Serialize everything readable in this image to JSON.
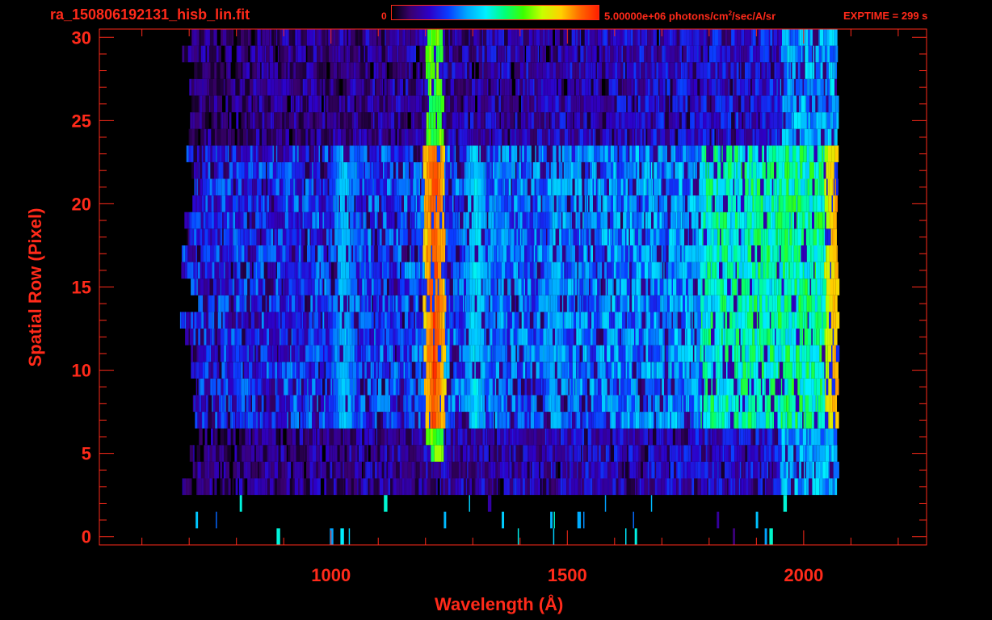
{
  "header": {
    "filename": "ra_150806192131_hisb_lin.fit",
    "colorbar_min_label": "0",
    "colorbar_max_label_pre": "5.00000e+06 photons/cm",
    "colorbar_max_label_sup": "2",
    "colorbar_max_label_post": "/sec/A/sr",
    "exptime_label": "EXPTIME = 299 s"
  },
  "colors": {
    "axis": "#ff2a1a",
    "background": "#000000",
    "colormap": [
      "#000000",
      "#3a0070",
      "#2d00c8",
      "#0a3cff",
      "#00a8ff",
      "#00f0ff",
      "#00ff7a",
      "#3cff00",
      "#c8ff00",
      "#ffd000",
      "#ff6a00",
      "#ff2000"
    ]
  },
  "chart_data": {
    "type": "heatmap",
    "title": "ra_150806192131_hisb_lin.fit",
    "xlabel": "Wavelength (Å)",
    "ylabel": "Spatial Row (Pixel)",
    "xlim": [
      510,
      2260
    ],
    "ylim": [
      -0.5,
      30.5
    ],
    "x_ticks": [
      1000,
      1500,
      2000
    ],
    "y_ticks": [
      0,
      5,
      10,
      15,
      20,
      25,
      30
    ],
    "colorbar": {
      "min": 0,
      "max": 5000000,
      "unit": "photons/cm^2/sec/A/sr"
    },
    "grid": false,
    "data_x_range": [
      690,
      2070
    ],
    "slit_rows": [
      7,
      23
    ],
    "emission_features": [
      {
        "wavelength": 1025,
        "relative_intensity": 0.42
      },
      {
        "wavelength": 1216,
        "relative_intensity": 0.95
      },
      {
        "wavelength": 1304,
        "relative_intensity": 0.45
      },
      {
        "wavelength": 1356,
        "relative_intensity": 0.32
      },
      {
        "wavelength": 1470,
        "relative_intensity": 0.38
      },
      {
        "wavelength": 2065,
        "relative_intensity": 0.85
      }
    ]
  }
}
